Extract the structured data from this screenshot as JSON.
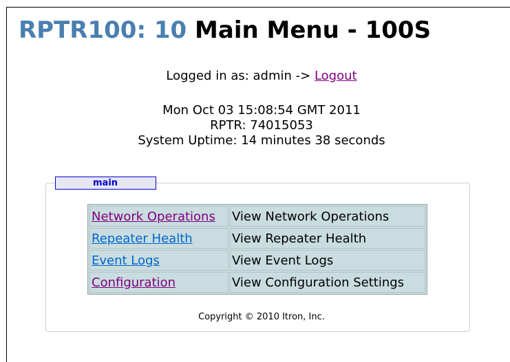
{
  "header": {
    "device_label": "RPTR100: 10",
    "menu_title": "Main Menu - 100S"
  },
  "session": {
    "logged_in_prefix": "Logged in as: admin ->",
    "logout_label": "Logout"
  },
  "status": {
    "datetime": "Mon Oct 03 15:08:54 GMT 2011",
    "rptr": "RPTR: 74015053",
    "uptime": "System Uptime: 14 minutes 38 seconds"
  },
  "panel": {
    "tab_label": "main",
    "menu": [
      {
        "link": "Network Operations",
        "description": "View Network Operations"
      },
      {
        "link": "Repeater Health",
        "description": "View Repeater Health"
      },
      {
        "link": "Event Logs",
        "description": "View Event Logs"
      },
      {
        "link": "Configuration",
        "description": "View Configuration Settings"
      }
    ],
    "copyright": "Copyright © 2010 Itron, Inc."
  },
  "colors": {
    "title_device": "#4a7fb0",
    "visited_link": "#800080",
    "unvisited_link": "#0066cc",
    "table_cell_bg": "#c9dcdf",
    "tab_border": "#0000cc"
  }
}
